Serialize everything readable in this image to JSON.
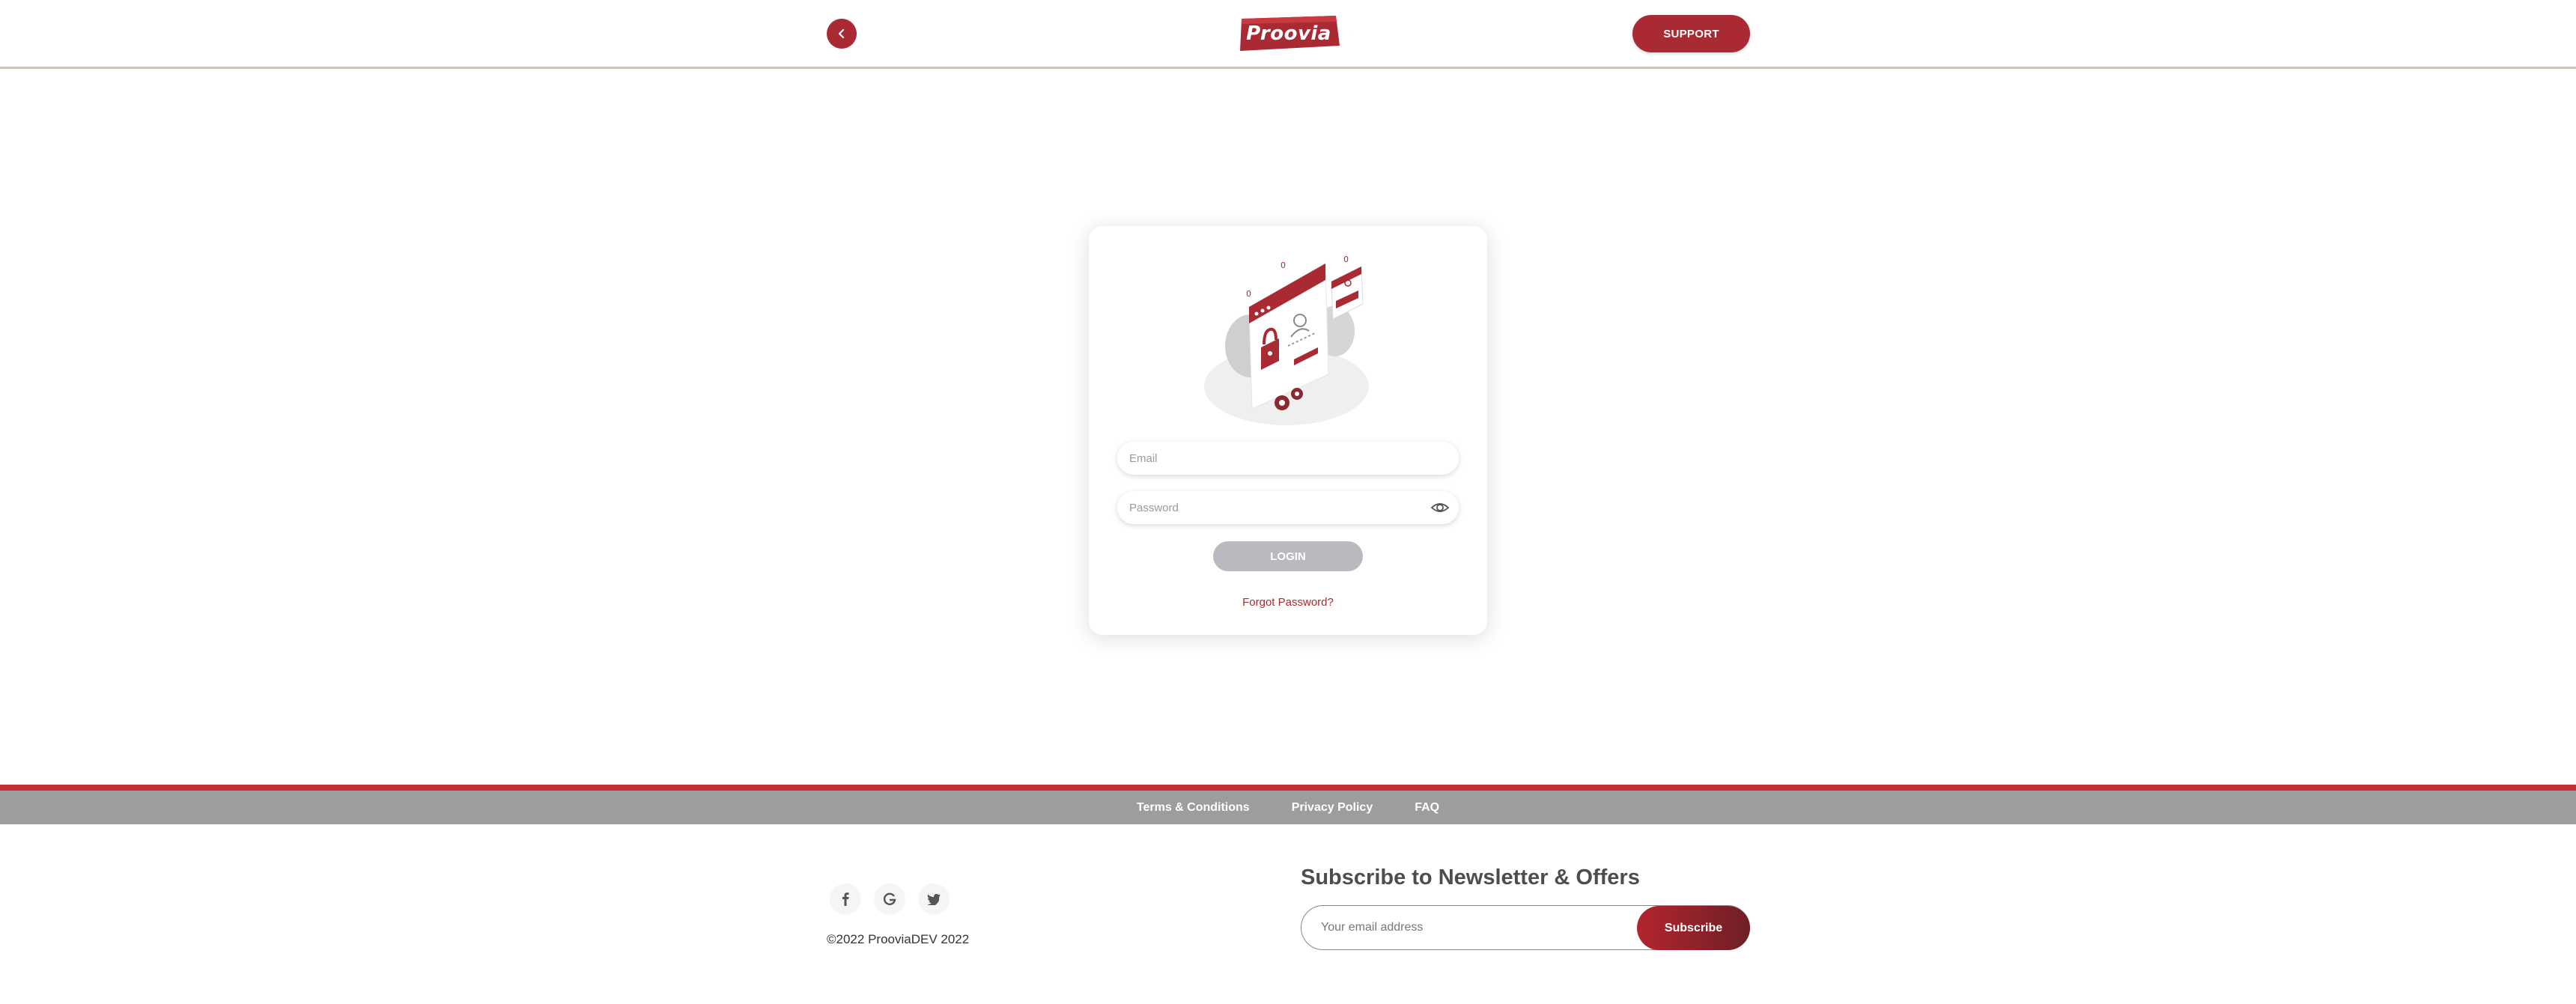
{
  "header": {
    "logo_text": "Proovia",
    "support_label": "SUPPORT",
    "back_icon": "chevron-left-icon"
  },
  "login": {
    "email_placeholder": "Email",
    "password_placeholder": "Password",
    "login_label": "LOGIN",
    "forgot_label": "Forgot Password?",
    "eye_icon": "eye-icon"
  },
  "footer": {
    "links": [
      "Terms & Conditions",
      "Privacy Policy",
      "FAQ"
    ],
    "social_icons": [
      "facebook-icon",
      "google-icon",
      "twitter-icon"
    ],
    "copyright": "©2022 ProoviaDEV 2022",
    "newsletter_title": "Subscribe to Newsletter & Offers",
    "newsletter_placeholder": "Your email address",
    "subscribe_label": "Subscribe"
  },
  "colors": {
    "brand_red": "#a92a32",
    "footer_red": "#c22f36",
    "footer_gray": "#9d9d9d",
    "login_disabled": "#b9b9bf",
    "header_border": "#d8c3aa"
  }
}
